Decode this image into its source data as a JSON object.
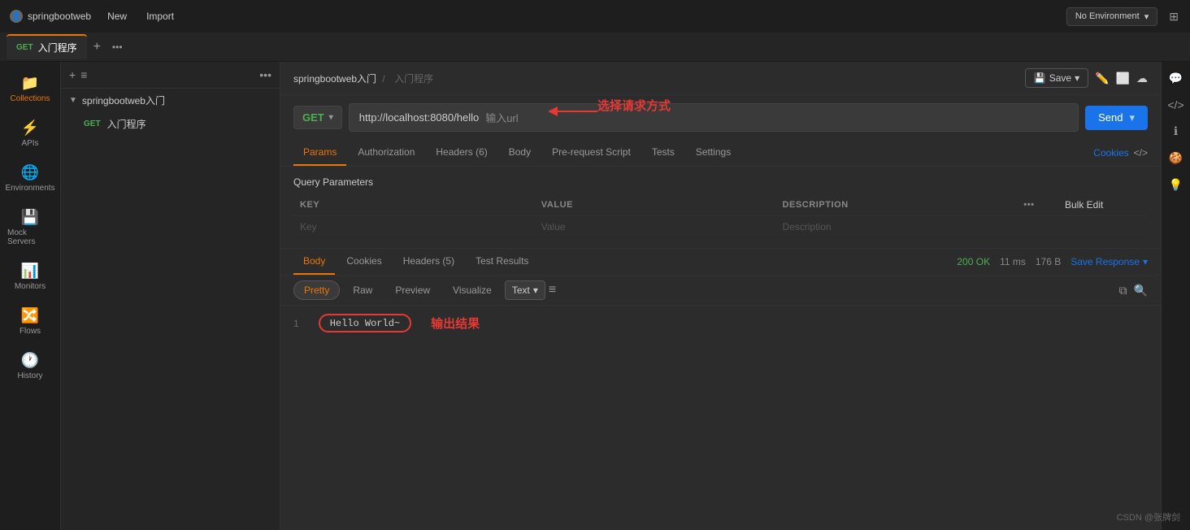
{
  "app": {
    "user": "springbootweb",
    "new_label": "New",
    "import_label": "Import",
    "env_label": "No Environment",
    "env_chevron": "▾"
  },
  "tabs": [
    {
      "method": "GET",
      "name": "入门程序",
      "active": true
    }
  ],
  "breadcrumb": {
    "collection": "springbootweb入门",
    "separator": "/",
    "request": "入门程序"
  },
  "header_actions": {
    "save": "Save",
    "save_chevron": "▾"
  },
  "request": {
    "method": "GET",
    "url": "http://localhost:8080/hello",
    "url_placeholder": "输入url",
    "send": "Send"
  },
  "req_tabs": [
    {
      "label": "Params",
      "active": true
    },
    {
      "label": "Authorization",
      "active": false
    },
    {
      "label": "Headers (6)",
      "active": false
    },
    {
      "label": "Body",
      "active": false
    },
    {
      "label": "Pre-request Script",
      "active": false
    },
    {
      "label": "Tests",
      "active": false
    },
    {
      "label": "Settings",
      "active": false
    }
  ],
  "cookies_link": "Cookies",
  "params": {
    "section_title": "Query Parameters",
    "columns": [
      "KEY",
      "VALUE",
      "DESCRIPTION",
      "•••",
      "Bulk Edit"
    ],
    "key_placeholder": "Key",
    "value_placeholder": "Value",
    "desc_placeholder": "Description"
  },
  "annotation_select_method": "选择请求方式",
  "response": {
    "tabs": [
      {
        "label": "Body",
        "active": true
      },
      {
        "label": "Cookies",
        "active": false
      },
      {
        "label": "Headers (5)",
        "active": false
      },
      {
        "label": "Test Results",
        "active": false
      }
    ],
    "status_code": "200 OK",
    "time": "11 ms",
    "size": "176 B",
    "save_response": "Save Response",
    "formats": [
      {
        "label": "Pretty",
        "active": true
      },
      {
        "label": "Raw",
        "active": false
      },
      {
        "label": "Preview",
        "active": false
      },
      {
        "label": "Visualize",
        "active": false
      }
    ],
    "text_select": "Text",
    "line_number": "1",
    "content": "Hello World~",
    "output_annotation": "输出结果"
  },
  "sidebar": {
    "items": [
      {
        "icon": "📁",
        "label": "Collections",
        "active": true
      },
      {
        "icon": "⚡",
        "label": "APIs"
      },
      {
        "icon": "🌐",
        "label": "Environments"
      },
      {
        "icon": "💾",
        "label": "Mock Servers"
      },
      {
        "icon": "📊",
        "label": "Monitors"
      },
      {
        "icon": "🔀",
        "label": "Flows"
      },
      {
        "icon": "🕐",
        "label": "History"
      }
    ]
  },
  "collections_panel": {
    "collection_name": "springbootweb入门",
    "request_name": "入门程序",
    "request_method": "GET"
  },
  "watermark": "CSDN @张牌剑"
}
